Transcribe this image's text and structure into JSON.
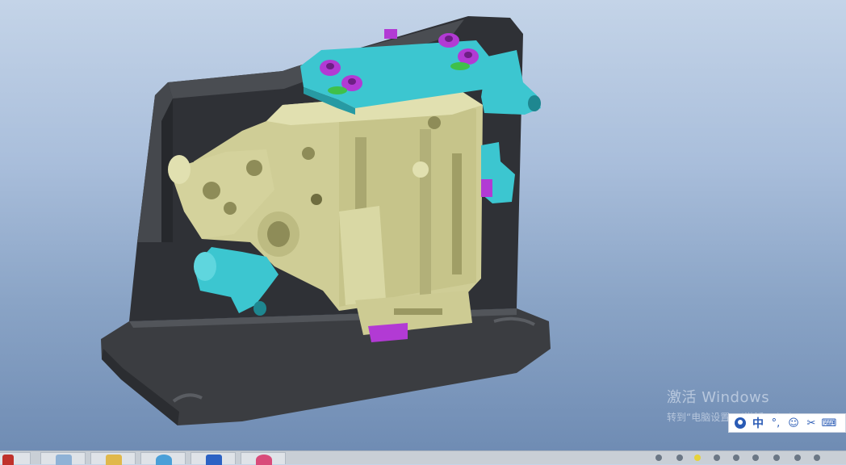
{
  "watermark": {
    "title": "激活 Windows",
    "subtitle": "转到“电脑设置”以激活 Windows。"
  },
  "ime": {
    "language": "中",
    "punctuation": "°,",
    "emoji": "☺",
    "tools": "✂",
    "keyboard": "⌨"
  },
  "taskbar": {
    "apps": [
      "file-explorer-icon",
      "windows-explorer-icon",
      "store-icon",
      "app-icon",
      "browser-icon"
    ]
  },
  "colors": {
    "background_top": "#c4d4e8",
    "background_bottom": "#6d8ab2",
    "fixture_base": "#3b3d41",
    "part_body": "#d1d19a",
    "clamp_cyan": "#36c2cc",
    "bolt_magenta": "#b23ad4"
  }
}
